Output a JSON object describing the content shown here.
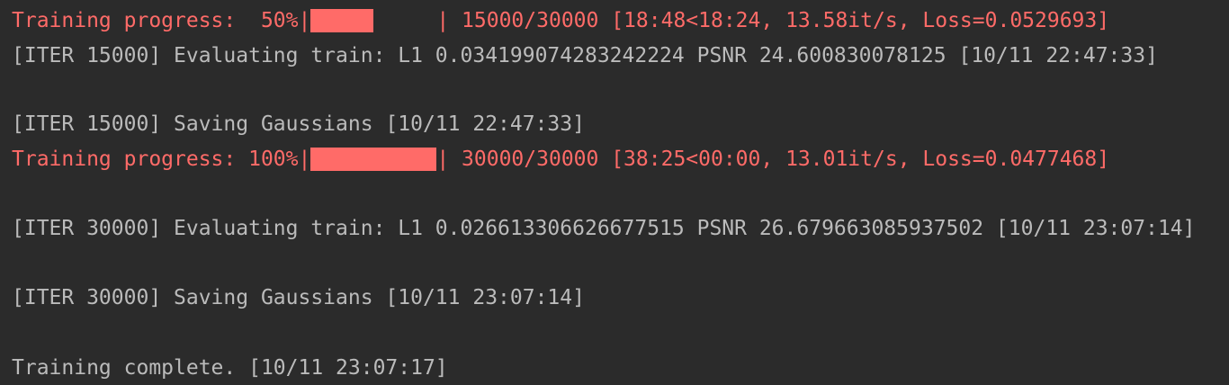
{
  "console": {
    "line1": {
      "prefix": "Training progress:  50%|",
      "bar_percent": 50,
      "suffix": "| 15000/30000 [18:48<18:24, 13.58it/s, Loss=0.0529693]"
    },
    "line2": "[ITER 15000] Evaluating train: L1 0.034199074283242224 PSNR 24.600830078125 [10/11 22:47:33]",
    "line3": "[ITER 15000] Saving Gaussians [10/11 22:47:33]",
    "line4": {
      "prefix": "Training progress: 100%|",
      "bar_percent": 100,
      "suffix": "| 30000/30000 [38:25<00:00, 13.01it/s, Loss=0.0477468]"
    },
    "line5": "[ITER 30000] Evaluating train: L1 0.026613306626677515 PSNR 26.679663085937502 [10/11 23:07:14]",
    "line6": "[ITER 30000] Saving Gaussians [10/11 23:07:14]",
    "line7": "Training complete. [10/11 23:07:17]"
  },
  "colors": {
    "background": "#2b2b2b",
    "stderr_text": "#ff6b68",
    "stdout_text": "#bbbbbb"
  }
}
